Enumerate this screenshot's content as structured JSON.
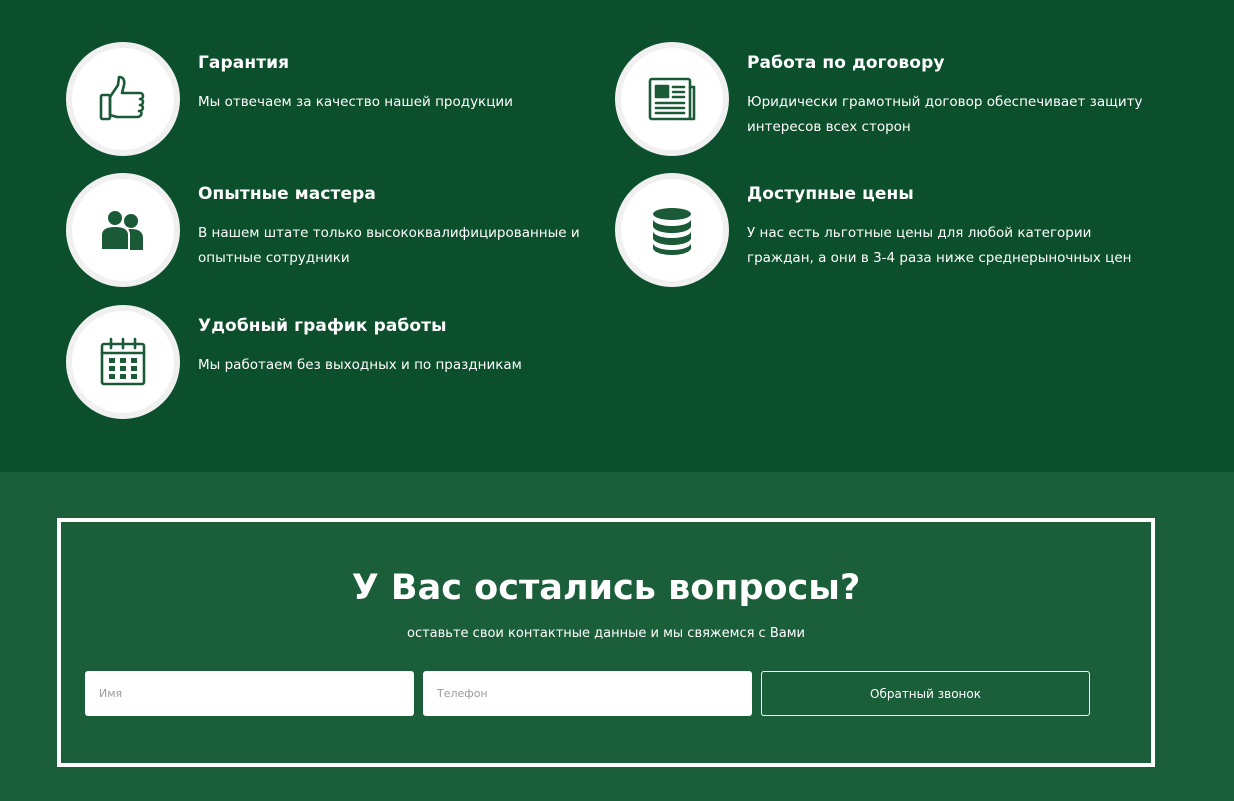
{
  "colors": {
    "features_bg": "#0c4f2c",
    "cta_bg": "#1a5e3a",
    "icon_color": "#1b5a36",
    "text": "#ffffff"
  },
  "features": [
    {
      "icon": "thumbs-up-icon",
      "title": "Гарантия",
      "desc": [
        "Мы отвечаем за качество нашей продукции"
      ]
    },
    {
      "icon": "document-icon",
      "title": "Работа по договору",
      "desc": [
        "Юридически грамотный договор обеспечивает защиту",
        "интересов всех сторон"
      ]
    },
    {
      "icon": "users-icon",
      "title": "Опытные мастера",
      "desc": [
        "В нашем штате только высококвалифицированные и",
        "опытные сотрудники"
      ]
    },
    {
      "icon": "coins-stack-icon",
      "title": "Доступные цены",
      "desc": [
        "У нас есть льготные цены для любой категории",
        "граждан, а они в 3-4 раза ниже среднерыночных цен"
      ]
    },
    {
      "icon": "calendar-icon",
      "title": "Удобный график работы",
      "desc": [
        "Мы работаем без выходных и по праздникам"
      ]
    }
  ],
  "cta": {
    "title": "У Вас остались вопросы?",
    "subtitle": "оставьте свои контактные данные и мы свяжемся с Вами",
    "name_placeholder": "Имя",
    "name_value": "",
    "phone_placeholder": "Телефон",
    "phone_value": "",
    "button_label": "Обратный звонок"
  }
}
